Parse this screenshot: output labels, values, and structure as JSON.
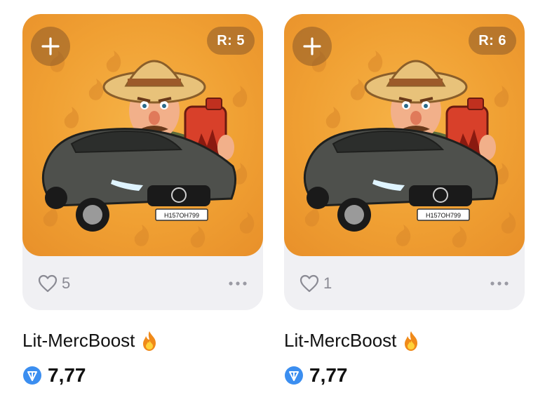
{
  "colors": {
    "art_background": "#f0a033",
    "tile_background": "#f0f0f3",
    "ton_blue": "#3b8ef0",
    "muted_text": "#8a8a93"
  },
  "cards": [
    {
      "add_icon": "plus-icon",
      "rank_label": "R: 5",
      "likes_icon": "heart-outline-icon",
      "likes_count": "5",
      "more_icon": "more-dots-icon",
      "title": "Lit-MercBoost",
      "title_icon": "fire-icon",
      "currency_icon": "ton-icon",
      "price": "7,77",
      "plate_text": "H157OH799"
    },
    {
      "add_icon": "plus-icon",
      "rank_label": "R: 6",
      "likes_icon": "heart-outline-icon",
      "likes_count": "1",
      "more_icon": "more-dots-icon",
      "title": "Lit-MercBoost",
      "title_icon": "fire-icon",
      "currency_icon": "ton-icon",
      "price": "7,77",
      "plate_text": "H157OH799"
    }
  ]
}
